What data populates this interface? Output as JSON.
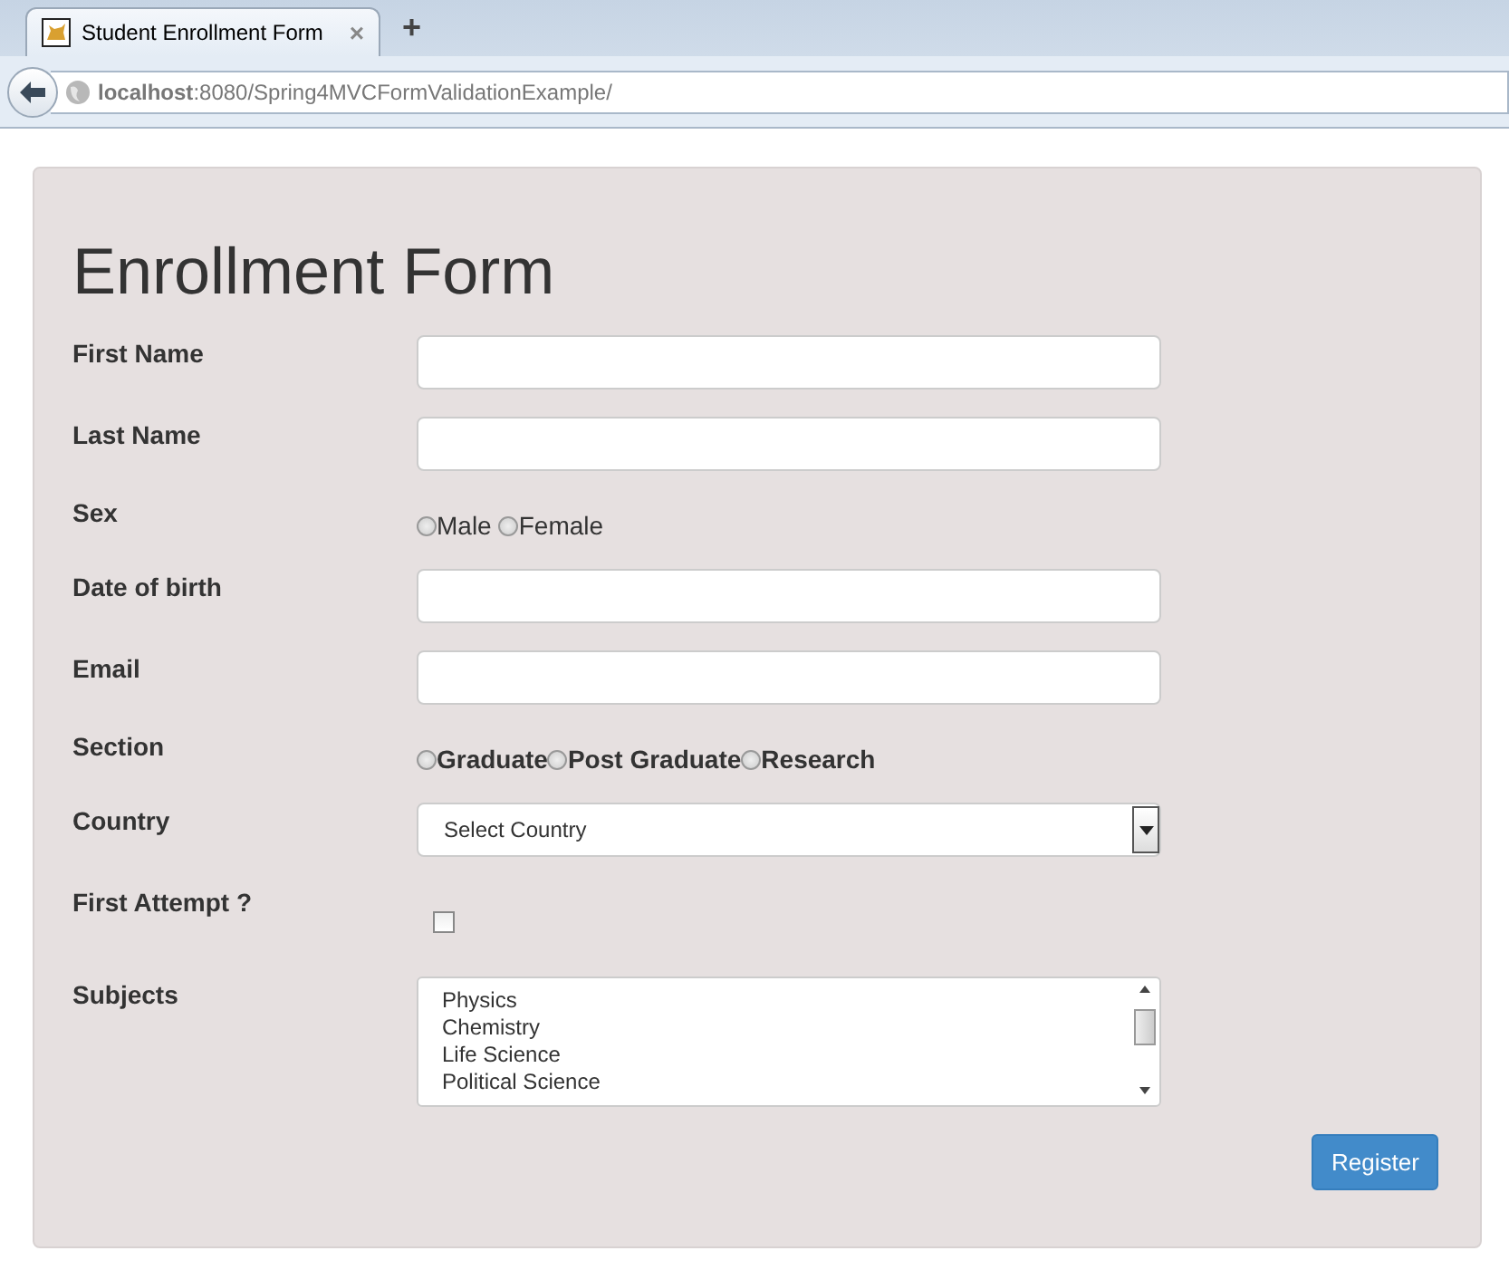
{
  "browser": {
    "tab": {
      "title": "Student Enrollment Form",
      "close": "×"
    },
    "new_tab": "+",
    "url": "**localhost**:8080/Spring4MVCFormValidationExample/"
  },
  "form": {
    "title": "Enrollment Form",
    "fields": [
      {
        "kind": "text",
        "label": "First Name"
      },
      {
        "kind": "text",
        "label": "Last Name"
      },
      {
        "kind": "radio",
        "label": "Sex",
        "bold": false,
        "options": [
          {
            "label": "Male",
            "selected": false
          },
          {
            "label": "Female",
            "selected": false
          }
        ]
      },
      {
        "kind": "text",
        "label": "Date of birth"
      },
      {
        "kind": "text",
        "label": "Email"
      },
      {
        "kind": "radio",
        "label": "Section",
        "bold": true,
        "options": [
          {
            "label": "Graduate",
            "selected": false
          },
          {
            "label": "Post Graduate",
            "selected": false
          },
          {
            "label": "Research",
            "selected": false
          }
        ]
      },
      {
        "kind": "select",
        "label": "Country",
        "value": "Select Country"
      },
      {
        "kind": "checkbox",
        "label": "First Attempt ?",
        "checked": false
      },
      {
        "kind": "list",
        "label": "Subjects",
        "items": [
          {
            "label": "Physics",
            "selected": false
          },
          {
            "label": "Chemistry",
            "selected": false
          },
          {
            "label": "Life Science",
            "selected": false
          },
          {
            "label": "Political Science",
            "selected": false
          }
        ]
      }
    ],
    "submit": "Register"
  }
}
